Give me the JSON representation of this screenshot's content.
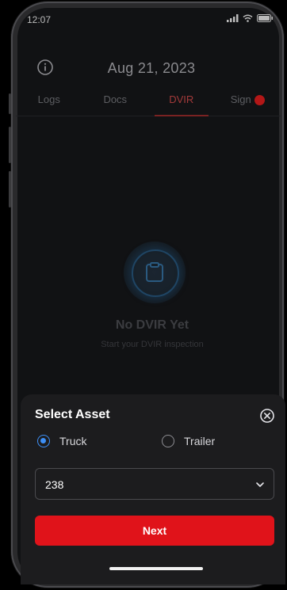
{
  "status_bar": {
    "time": "12:07"
  },
  "header": {
    "date": "Aug 21, 2023"
  },
  "tabs": [
    {
      "label": "Logs",
      "active": false
    },
    {
      "label": "Docs",
      "active": false
    },
    {
      "label": "DVIR",
      "active": true
    },
    {
      "label": "Sign",
      "active": false,
      "badge": true
    }
  ],
  "empty_state": {
    "title": "No DVIR Yet",
    "subtitle": "Start your DVIR inspection"
  },
  "sheet": {
    "title": "Select Asset",
    "options": [
      {
        "label": "Truck",
        "checked": true
      },
      {
        "label": "Trailer",
        "checked": false
      }
    ],
    "select_value": "238",
    "next_label": "Next"
  },
  "colors": {
    "accent_red": "#e0131a",
    "radio_blue": "#3d8ff5",
    "sheet_bg": "#1c1c1e"
  }
}
